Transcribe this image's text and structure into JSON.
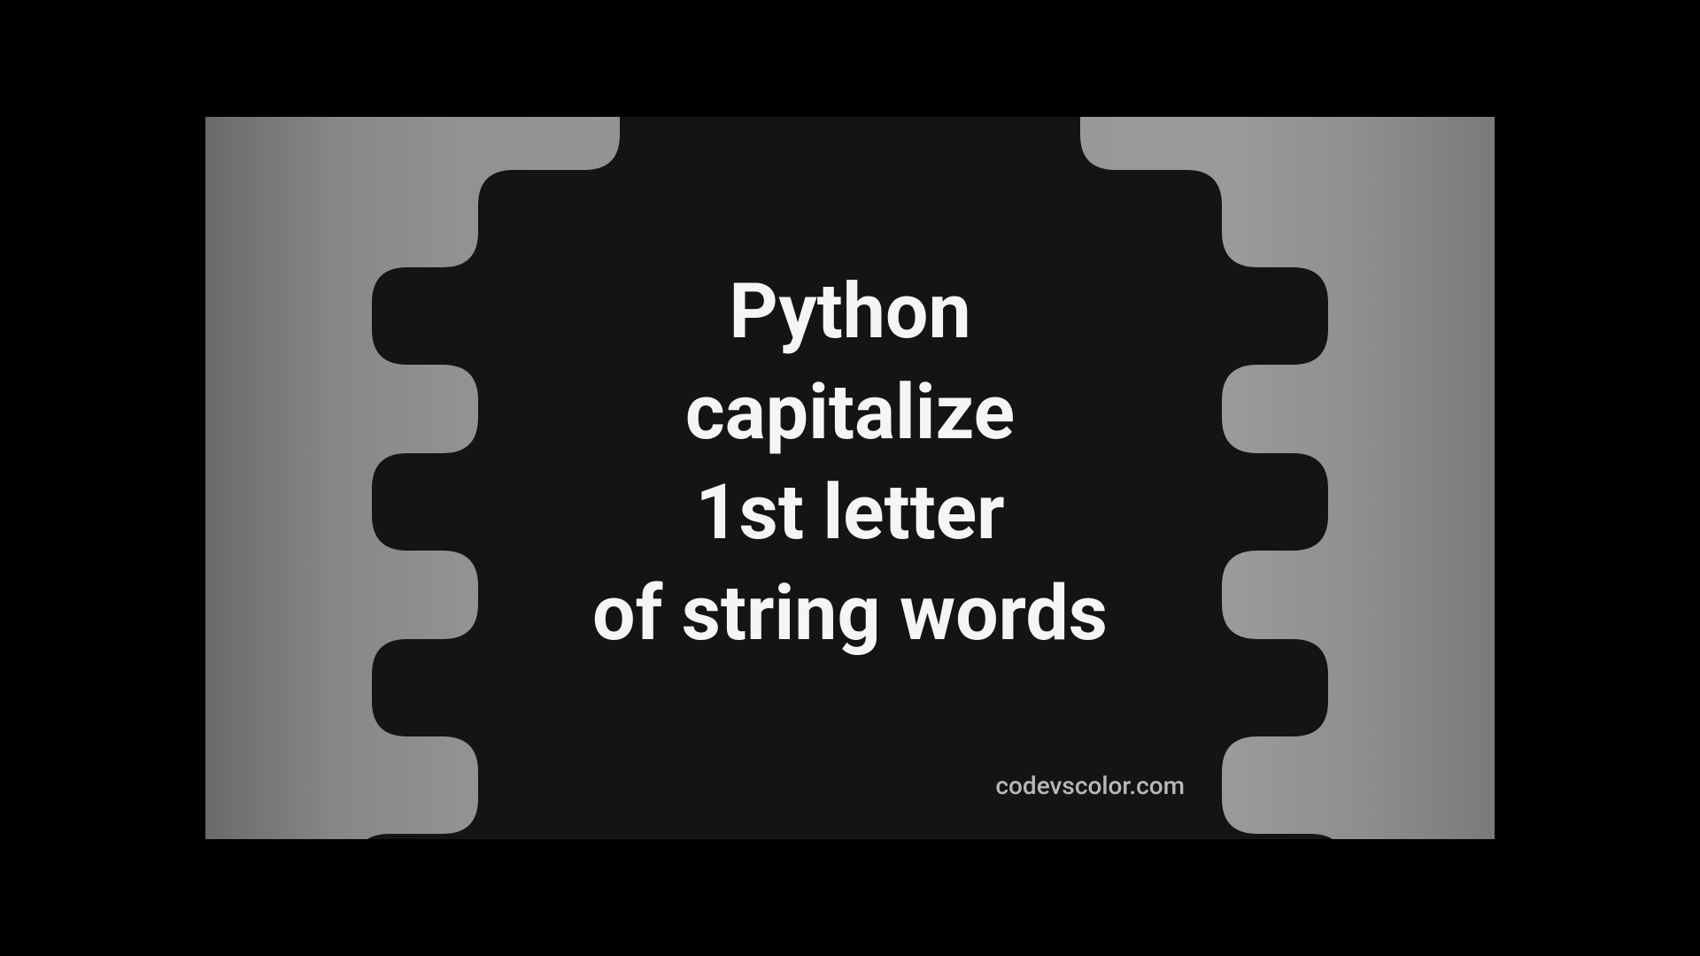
{
  "heading": {
    "line1": "Python",
    "line2": "capitalize",
    "line3": "1st letter",
    "line4": "of string words"
  },
  "watermark": "codevscolor.com",
  "colors": {
    "blob": "#141414",
    "text": "#f5f5f5",
    "watermark": "#b8b8b8"
  }
}
